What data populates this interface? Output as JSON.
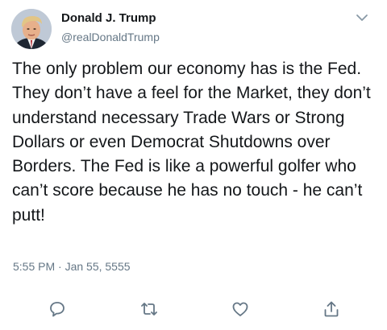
{
  "user": {
    "display_name": "Donald J. Trump",
    "handle": "@realDonaldTrump",
    "avatar_icon": "profile-photo"
  },
  "tweet": {
    "text": "The only problem our economy has is the Fed. They don’t have a feel for the Market, they don’t understand necessary Trade Wars or Strong Dollars or even Democrat Shutdowns over Borders. The Fed is like a powerful golfer who can’t score because he has no touch - he can’t putt!",
    "timestamp": "5:55 PM · Jan 55, 5555"
  },
  "actions": {
    "reply_icon": "speech-bubble-icon",
    "retweet_icon": "retweet-arrows-icon",
    "like_icon": "heart-icon",
    "share_icon": "share-upload-icon"
  },
  "colors": {
    "text": "#14171a",
    "secondary": "#657786",
    "background": "#ffffff"
  }
}
